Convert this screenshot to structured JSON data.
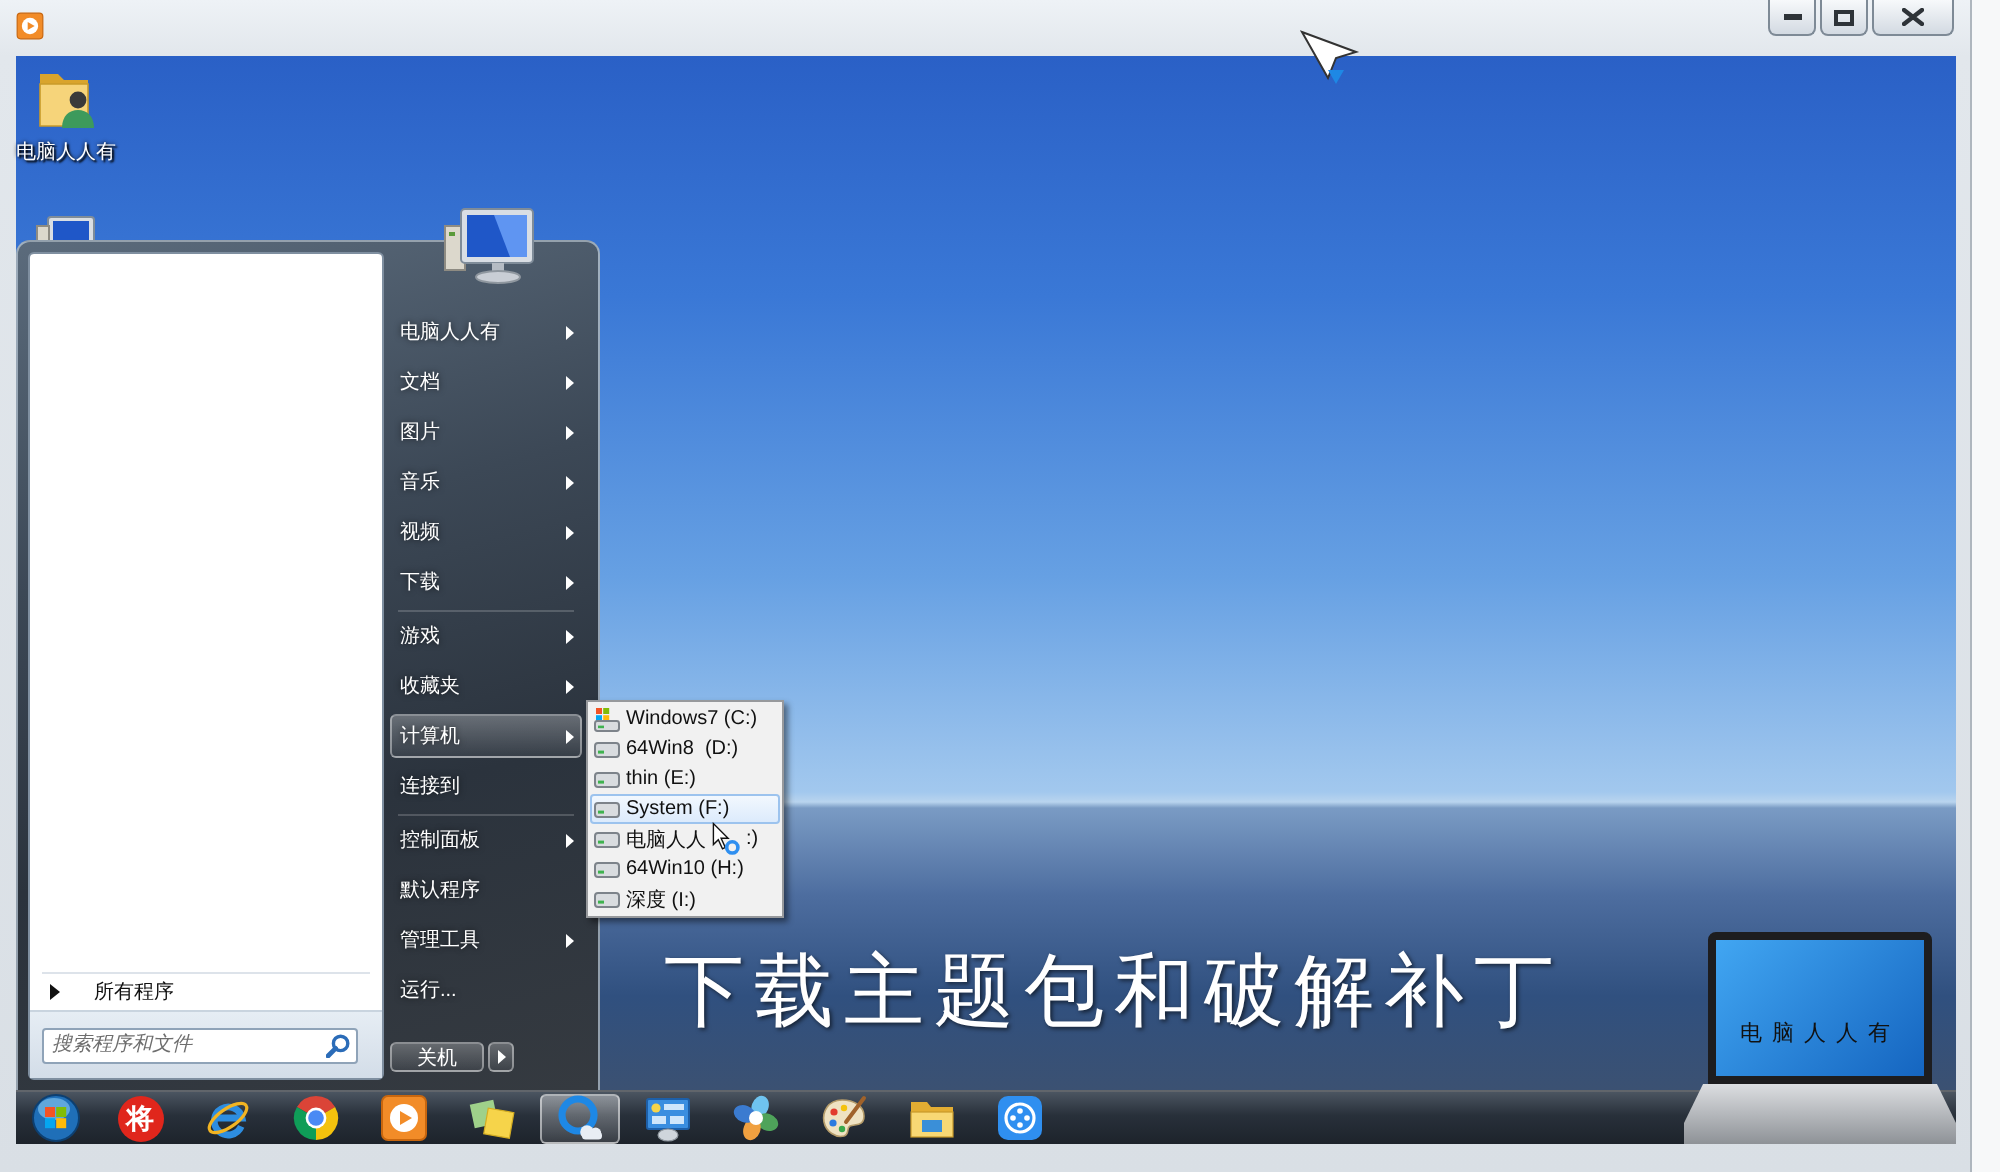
{
  "desktop": {
    "icons": [
      {
        "label": "电脑人人有"
      }
    ]
  },
  "start_menu": {
    "all_programs": "所有程序",
    "search": {
      "placeholder": "搜索程序和文件"
    },
    "place_groups": [
      {
        "items": [
          {
            "label": "电脑人人有",
            "submenu": true,
            "selected": false
          },
          {
            "label": "文档",
            "submenu": true,
            "selected": false
          },
          {
            "label": "图片",
            "submenu": true,
            "selected": false
          },
          {
            "label": "音乐",
            "submenu": true,
            "selected": false
          },
          {
            "label": "视频",
            "submenu": true,
            "selected": false
          },
          {
            "label": "下载",
            "submenu": true,
            "selected": false
          }
        ]
      },
      {
        "items": [
          {
            "label": "游戏",
            "submenu": true,
            "selected": false
          },
          {
            "label": "收藏夹",
            "submenu": true,
            "selected": false
          },
          {
            "label": "计算机",
            "submenu": true,
            "selected": true
          },
          {
            "label": "连接到",
            "submenu": false,
            "selected": false
          }
        ]
      },
      {
        "items": [
          {
            "label": "控制面板",
            "submenu": true,
            "selected": false
          },
          {
            "label": "默认程序",
            "submenu": false,
            "selected": false
          },
          {
            "label": "管理工具",
            "submenu": true,
            "selected": false
          },
          {
            "label": "运行...",
            "submenu": false,
            "selected": false
          }
        ]
      }
    ],
    "shutdown": {
      "label": "关机"
    }
  },
  "drive_menu": {
    "items": [
      {
        "label": "Windows7 (C:)",
        "kind": "system",
        "selected": false
      },
      {
        "label": "64Win8  (D:)",
        "kind": "drive",
        "selected": false
      },
      {
        "label": "thin (E:)",
        "kind": "drive",
        "selected": false
      },
      {
        "label": "System (F:)",
        "kind": "drive",
        "selected": true
      },
      {
        "label": "电脑人人",
        "label_end": ":)",
        "kind": "drive",
        "selected": false
      },
      {
        "label": "64Win10 (H:)",
        "kind": "drive",
        "selected": false
      },
      {
        "label": "深度 (I:)",
        "kind": "drive",
        "selected": false
      }
    ]
  },
  "caption": "下载主题包和破解补丁",
  "logo": {
    "text": "电脑人人有"
  },
  "taskbar": {
    "items": [
      {
        "kind": "start",
        "selected": false
      },
      {
        "kind": "glyph",
        "glyph": "将",
        "selected": false
      },
      {
        "kind": "browser-e",
        "selected": false
      },
      {
        "kind": "browser-round",
        "selected": false
      },
      {
        "kind": "player",
        "selected": false
      },
      {
        "kind": "notes",
        "selected": false
      },
      {
        "kind": "cloud",
        "selected": true
      },
      {
        "kind": "dashboard",
        "selected": false
      },
      {
        "kind": "pinwheel",
        "selected": false
      },
      {
        "kind": "palette",
        "selected": false
      },
      {
        "kind": "folder",
        "selected": false
      },
      {
        "kind": "reel",
        "selected": false
      }
    ]
  }
}
